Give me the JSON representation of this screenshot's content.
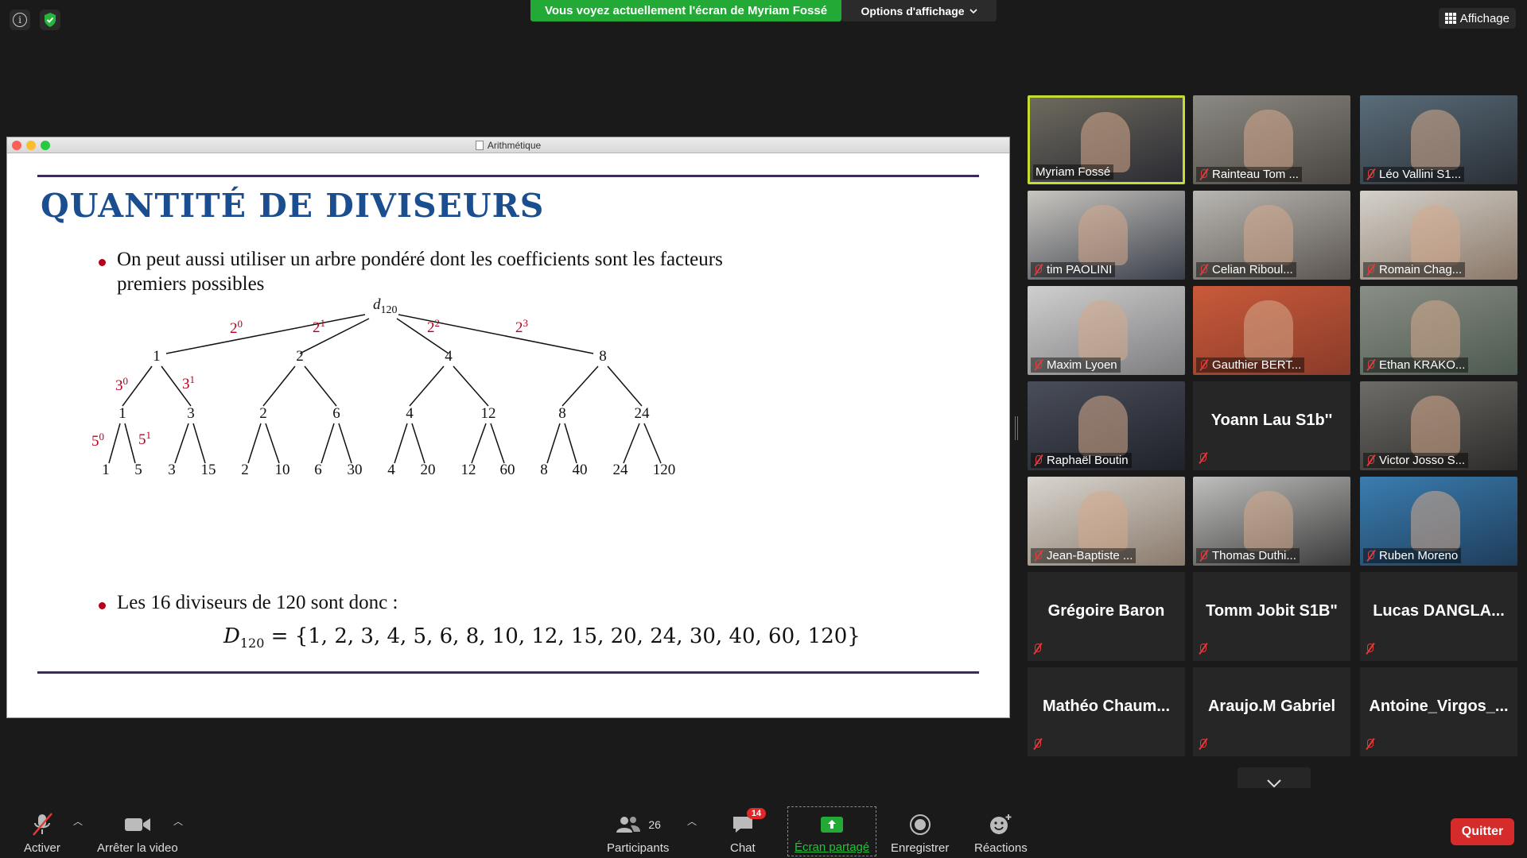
{
  "top_bar": {
    "share_banner": "Vous voyez actuellement l'écran de Myriam Fossé",
    "view_options": "Options d'affichage",
    "view_toggle": "Affichage"
  },
  "window": {
    "title": "Arithmétique"
  },
  "slide": {
    "title": "QUANTITÉ DE DIVISEURS",
    "bullet1_line1": "On peut aussi utiliser un arbre pondéré dont les coefficients sont les facteurs",
    "bullet1_line2": "premiers possibles",
    "bullet2": "Les 16 diviseurs de 120 sont donc :",
    "set_label": "D",
    "set_sub": "120",
    "set_values": "= {1, 2, 3, 4, 5, 6, 8, 10, 12, 15, 20, 24, 30, 40, 60, 120}",
    "tree": {
      "root_label": "d",
      "root_sub": "120",
      "weights_level1": [
        {
          "base": "2",
          "exp": "0"
        },
        {
          "base": "2",
          "exp": "1"
        },
        {
          "base": "2",
          "exp": "2"
        },
        {
          "base": "2",
          "exp": "3"
        }
      ],
      "weights_level2": [
        {
          "base": "3",
          "exp": "0"
        },
        {
          "base": "3",
          "exp": "1"
        }
      ],
      "weights_level3": [
        {
          "base": "5",
          "exp": "0"
        },
        {
          "base": "5",
          "exp": "1"
        }
      ],
      "level1": [
        "1",
        "2",
        "4",
        "8"
      ],
      "level2": [
        "1",
        "3",
        "2",
        "6",
        "4",
        "12",
        "8",
        "24"
      ],
      "level3": [
        "1",
        "5",
        "3",
        "15",
        "2",
        "10",
        "6",
        "30",
        "4",
        "20",
        "12",
        "60",
        "8",
        "40",
        "24",
        "120"
      ]
    }
  },
  "participants": [
    {
      "name": "Myriam Fossé",
      "video": true,
      "active": true,
      "muted": false
    },
    {
      "name": "Rainteau Tom ...",
      "video": true,
      "muted": true
    },
    {
      "name": "Léo Vallini S1...",
      "video": true,
      "muted": true
    },
    {
      "name": "tim PAOLINI",
      "video": true,
      "muted": true
    },
    {
      "name": "Celian Riboul...",
      "video": true,
      "muted": true
    },
    {
      "name": "Romain Chag...",
      "video": true,
      "muted": true
    },
    {
      "name": "Maxim Lyoen",
      "video": true,
      "muted": true
    },
    {
      "name": "Gauthier BERT...",
      "video": true,
      "muted": true
    },
    {
      "name": "Ethan KRAKO...",
      "video": true,
      "muted": true
    },
    {
      "name": "Raphaël Boutin",
      "video": true,
      "muted": true
    },
    {
      "name": "Yoann Lau S1b''",
      "video": false,
      "muted": true
    },
    {
      "name": "Victor Josso S...",
      "video": true,
      "muted": true
    },
    {
      "name": "Jean-Baptiste ...",
      "video": true,
      "muted": true
    },
    {
      "name": "Thomas Duthi...",
      "video": true,
      "muted": true
    },
    {
      "name": "Ruben Moreno",
      "video": true,
      "muted": true
    },
    {
      "name": "Grégoire Baron",
      "video": false,
      "muted": true
    },
    {
      "name": "Tomm Jobit S1B\"",
      "video": false,
      "muted": true
    },
    {
      "name": "Lucas  DANGLA...",
      "video": false,
      "muted": true
    },
    {
      "name": "Mathéo  Chaum...",
      "video": false,
      "muted": true
    },
    {
      "name": "Araujo.M Gabriel",
      "video": false,
      "muted": true
    },
    {
      "name": "Antoine_Virgos_...",
      "video": false,
      "muted": true
    }
  ],
  "toolbar": {
    "unmute": "Activer",
    "stop_video": "Arrêter la video",
    "participants": "Participants",
    "participants_count": "26",
    "chat": "Chat",
    "chat_badge": "14",
    "share": "Écran partagé",
    "record": "Enregistrer",
    "reactions": "Réactions",
    "leave": "Quitter"
  },
  "colors": {
    "share_green": "#23a936",
    "active_speaker": "#c7dc33",
    "leave_red": "#d52b2b",
    "slide_title_blue": "#1b4e8f",
    "weight_red": "#b8001c"
  }
}
